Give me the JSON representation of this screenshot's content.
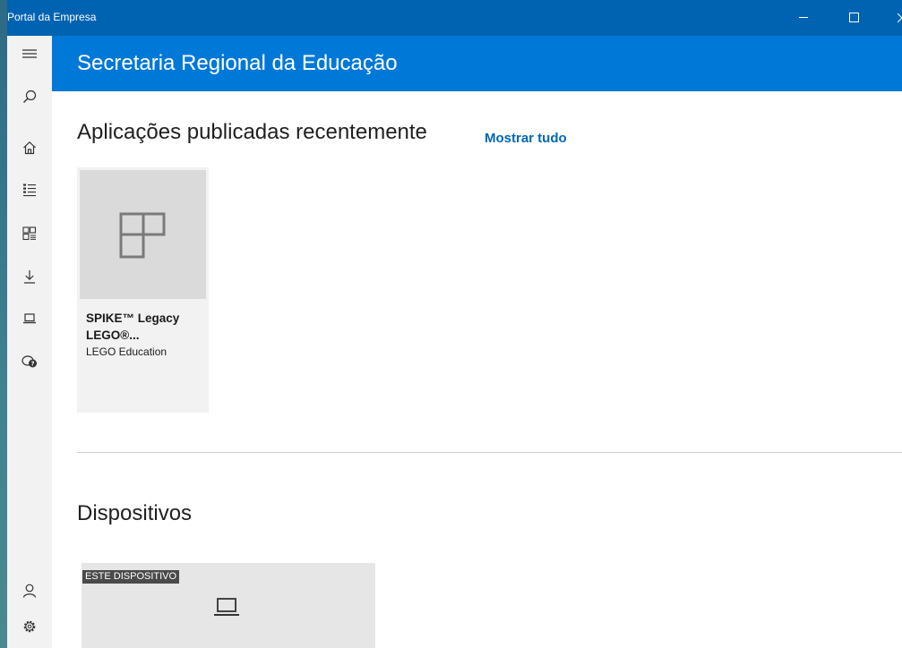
{
  "window": {
    "title": "Portal da Empresa",
    "controls": {
      "minimize_icon": "minimize-icon",
      "maximize_icon": "maximize-icon",
      "close_icon": "close-icon"
    }
  },
  "nav_rail": {
    "icons": [
      "hamburger-menu-icon",
      "search-icon",
      "home-icon",
      "list-icon",
      "apps-grid-icon",
      "download-icon",
      "laptop-icon",
      "help-chat-icon",
      "account-icon",
      "settings-gear-icon"
    ]
  },
  "header": {
    "title": "Secretaria Regional da Educação"
  },
  "recent_apps": {
    "title": "Aplicações publicadas recentemente",
    "show_all": "Mostrar tudo",
    "items": [
      {
        "name": "SPIKE™ Legacy LEGO®...",
        "publisher": "LEGO Education",
        "icon": "app-placeholder-icon"
      }
    ]
  },
  "devices": {
    "title": "Dispositivos",
    "items": [
      {
        "badge": "ESTE DISPOSITIVO",
        "icon": "laptop-icon"
      }
    ]
  },
  "colors": {
    "titlebar": "#0063b1",
    "header": "#0078d7",
    "accent_link": "#0067b8",
    "rail": "#f2f2f2",
    "tile": "#f2f2f2",
    "tile_image": "#dadada",
    "device_tile": "#e6e6e6",
    "badge": "#4a4a4a"
  }
}
